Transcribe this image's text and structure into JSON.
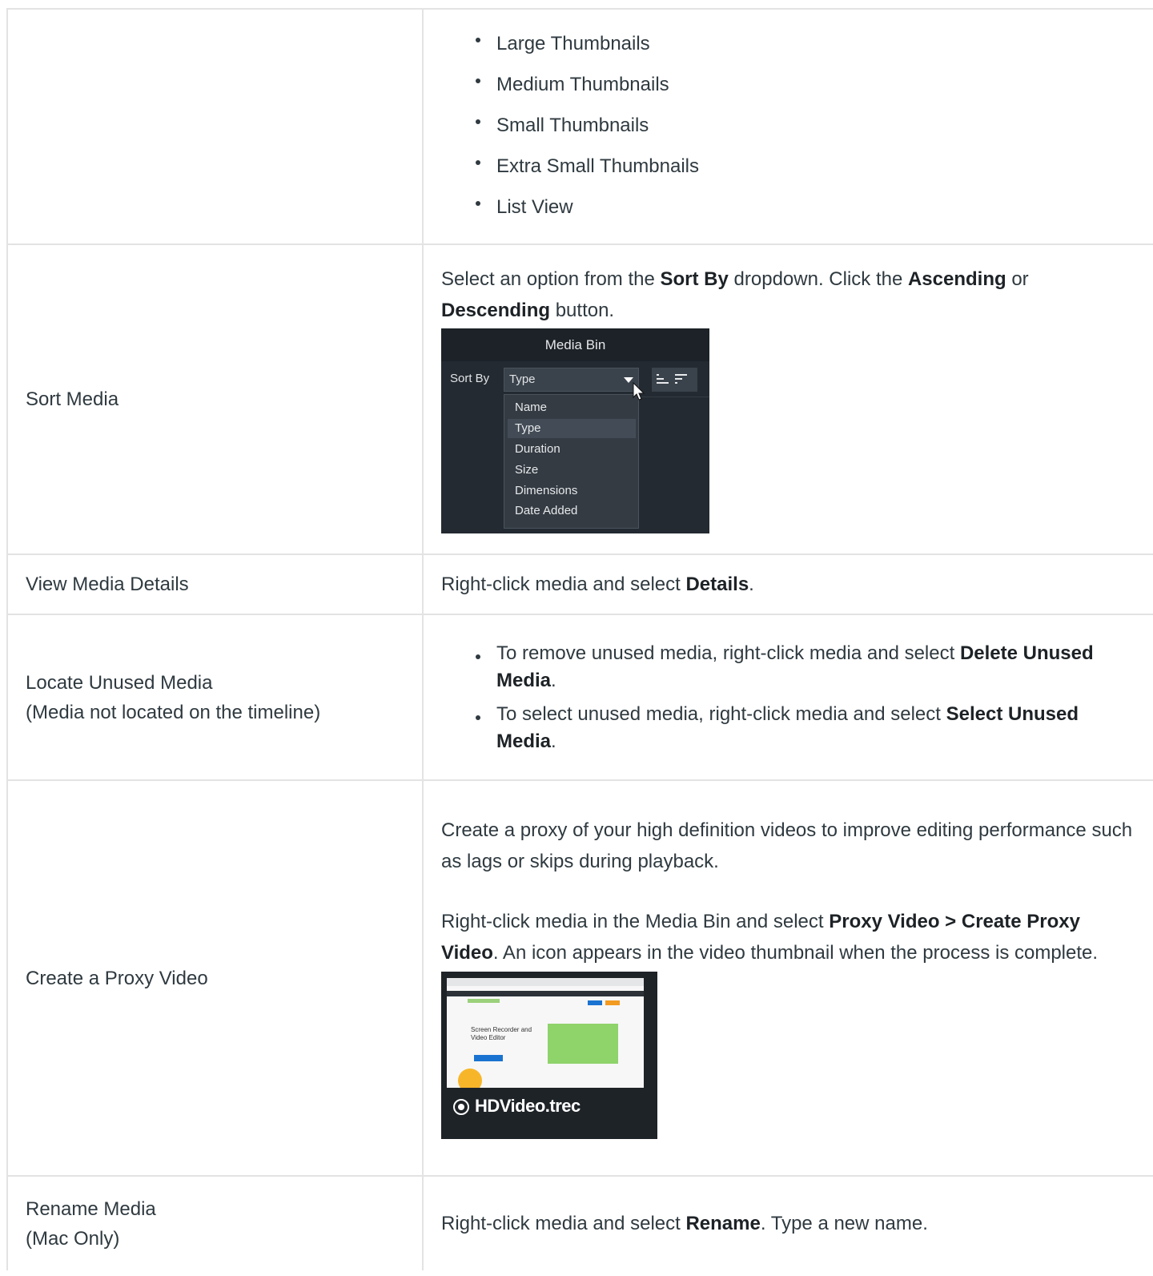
{
  "rows": [
    {
      "label": "",
      "views": [
        "Large Thumbnails",
        "Medium Thumbnails",
        "Small Thumbnails",
        "Extra Small Thumbnails",
        "List View"
      ]
    },
    {
      "label": "Sort Media",
      "text": {
        "p1": "Select an option from the ",
        "b1": "Sort By",
        "p2": " dropdown. Click the ",
        "b2": "Ascending",
        "p3": " or ",
        "b3": "Descending",
        "p4": " button."
      },
      "media_bin": {
        "title": "Media Bin",
        "sort_by_label": "Sort By",
        "selected": "Type",
        "options": [
          "Name",
          "Type",
          "Duration",
          "Size",
          "Dimensions",
          "Date Added"
        ],
        "icons": [
          "sort-ascending-icon",
          "sort-descending-icon",
          "cursor-icon",
          "chevron-down-icon"
        ]
      }
    },
    {
      "label": "View Media Details",
      "text": {
        "p1": "Right-click media and select ",
        "b1": "Details",
        "p2": "."
      }
    },
    {
      "label": "Locate Unused Media",
      "sublabel": "(Media not located on the timeline)",
      "bullets": [
        {
          "p1": "To remove unused media, right-click media and select ",
          "b1": "Delete Unused Media",
          "p2": "."
        },
        {
          "p1": "To select unused media, right-click media and select ",
          "b1": "Select Unused Media",
          "p2": "."
        }
      ]
    },
    {
      "label": "Create a Proxy Video",
      "para1": "Create a proxy of your high definition videos to improve editing performance such as lags or skips during playback.",
      "para2": {
        "p1": "Right-click media in the Media Bin and select ",
        "b1": "Proxy Video > Create Proxy Video",
        "p2": ". An icon appears in the video thumbnail when the process is complete."
      },
      "thumbnail": {
        "filename": "HDVideo.trec",
        "headline_line1": "Screen Recorder and",
        "headline_line2": "Video Editor",
        "icon": "record-icon"
      }
    },
    {
      "label": "Rename Media",
      "sublabel": "(Mac Only)",
      "text": {
        "p1": "Right-click media and select ",
        "b1": "Rename",
        "p2": ". Type a new name."
      }
    }
  ]
}
